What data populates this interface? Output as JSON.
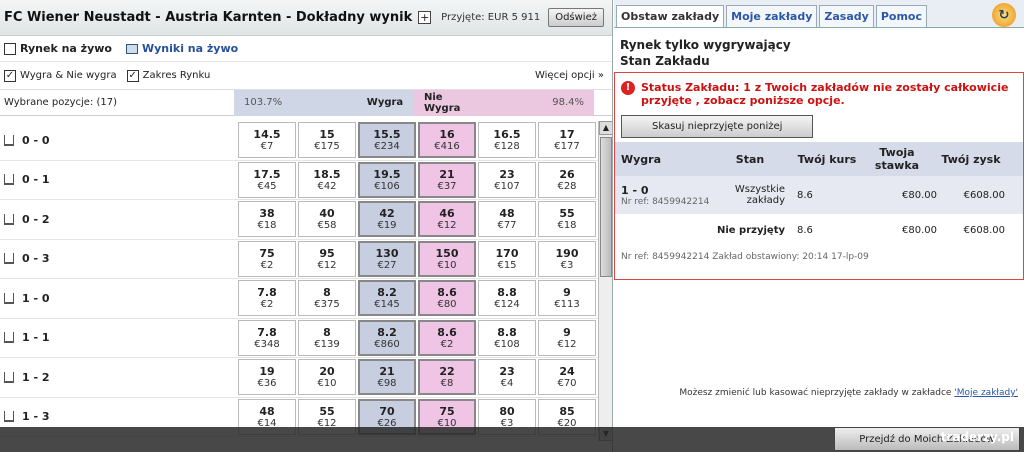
{
  "header": {
    "match_title": "FC Wiener Neustadt - Austria Karnten - Dokładny wynik",
    "plus": "+",
    "accepted": "Przyjęte: EUR 5 911",
    "refresh": "Odśwież"
  },
  "toolbar": {
    "live_market": "Rynek na żywo",
    "live_results": "Wyniki na żywo"
  },
  "options": {
    "win_nowin": "Wygra & Nie wygra",
    "market_range": "Zakres Rynku",
    "more_options": "Więcej opcji »",
    "check": "✓"
  },
  "grid_header": {
    "selected": "Wybrane pozycje:  (17)",
    "pct_left": "103.7%",
    "wygra": "Wygra",
    "nie_wygra": "Nie Wygra",
    "pct_right": "98.4%"
  },
  "rows": [
    {
      "score": "0 - 0",
      "c": [
        [
          "14.5",
          "€7"
        ],
        [
          "15",
          "€175"
        ],
        [
          "15.5",
          "€234"
        ],
        [
          "16",
          "€416"
        ],
        [
          "16.5",
          "€128"
        ],
        [
          "17",
          "€177"
        ]
      ]
    },
    {
      "score": "0 - 1",
      "c": [
        [
          "17.5",
          "€45"
        ],
        [
          "18.5",
          "€42"
        ],
        [
          "19.5",
          "€106"
        ],
        [
          "21",
          "€37"
        ],
        [
          "23",
          "€107"
        ],
        [
          "26",
          "€28"
        ]
      ]
    },
    {
      "score": "0 - 2",
      "c": [
        [
          "38",
          "€18"
        ],
        [
          "40",
          "€58"
        ],
        [
          "42",
          "€19"
        ],
        [
          "46",
          "€12"
        ],
        [
          "48",
          "€77"
        ],
        [
          "55",
          "€18"
        ]
      ]
    },
    {
      "score": "0 - 3",
      "c": [
        [
          "75",
          "€2"
        ],
        [
          "95",
          "€12"
        ],
        [
          "130",
          "€27"
        ],
        [
          "150",
          "€10"
        ],
        [
          "170",
          "€15"
        ],
        [
          "190",
          "€3"
        ]
      ]
    },
    {
      "score": "1 - 0",
      "c": [
        [
          "7.8",
          "€2"
        ],
        [
          "8",
          "€375"
        ],
        [
          "8.2",
          "€145"
        ],
        [
          "8.6",
          "€80"
        ],
        [
          "8.8",
          "€124"
        ],
        [
          "9",
          "€113"
        ]
      ]
    },
    {
      "score": "1 - 1",
      "c": [
        [
          "7.8",
          "€348"
        ],
        [
          "8",
          "€139"
        ],
        [
          "8.2",
          "€860"
        ],
        [
          "8.6",
          "€2"
        ],
        [
          "8.8",
          "€108"
        ],
        [
          "9",
          "€12"
        ]
      ]
    },
    {
      "score": "1 - 2",
      "c": [
        [
          "19",
          "€36"
        ],
        [
          "20",
          "€10"
        ],
        [
          "21",
          "€98"
        ],
        [
          "22",
          "€8"
        ],
        [
          "23",
          "€4"
        ],
        [
          "24",
          "€70"
        ]
      ]
    },
    {
      "score": "1 - 3",
      "c": [
        [
          "48",
          "€14"
        ],
        [
          "55",
          "€12"
        ],
        [
          "70",
          "€26"
        ],
        [
          "75",
          "€10"
        ],
        [
          "80",
          "€3"
        ],
        [
          "85",
          "€20"
        ]
      ]
    }
  ],
  "tabs": [
    "Obstaw zakłady",
    "Moje zakłady",
    "Zasady",
    "Pomoc"
  ],
  "right": {
    "title": "Rynek tylko wygrywający",
    "subtitle": "Stan Zakładu",
    "warn": "!",
    "status": "Status Zakładu: 1 z Twoich zakładów nie zostały całkowicie przyjęte , zobacz poniższe opcje.",
    "cancel_btn": "Skasuj nieprzyjęte poniżej",
    "cols": {
      "c1": "Wygra",
      "c2": "Stan",
      "c3": "Twój kurs",
      "c4": "Twoja stawka",
      "c5": "Twój zysk"
    },
    "bet1": {
      "pick": "1 - 0",
      "ref": "Nr ref: 8459942214",
      "state": "Wszystkie zakłady",
      "odds": "8.6",
      "stake": "€80.00",
      "profit": "€608.00"
    },
    "bet2": {
      "state": "Nie przyjęty",
      "odds": "8.6",
      "stake": "€80.00",
      "profit": "€608.00"
    },
    "footer_ref": "Nr ref: 8459942214 Zakład obstawiony: 20:14 17-lp-09",
    "help_text": "Możesz zmienić lub kasować nieprzyjęte zakłady w zakładce ",
    "help_link": "'Moje zakłady'",
    "goto_btn": "Przejdź do Moich Zakładów"
  },
  "watermark": "traderzy.pl"
}
